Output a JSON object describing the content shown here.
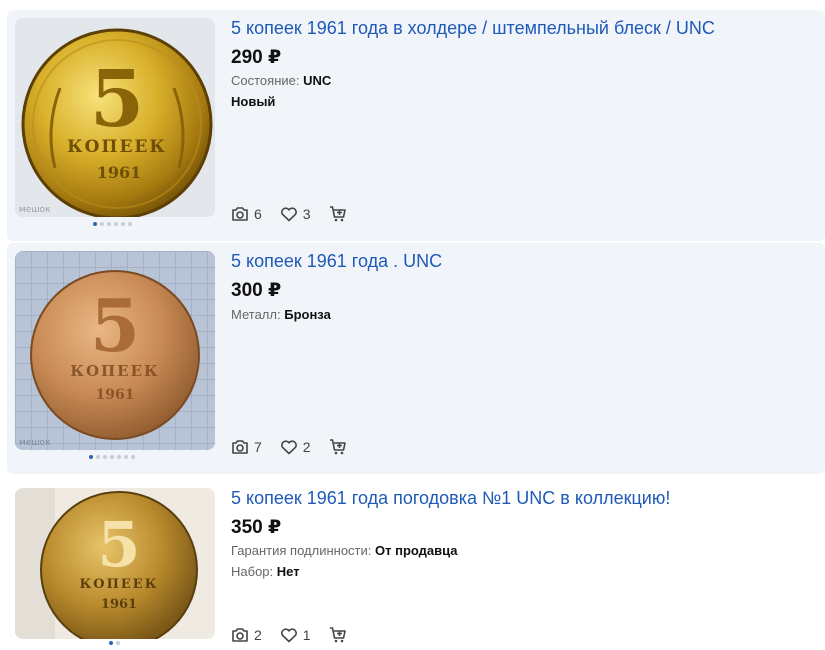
{
  "listings": [
    {
      "title": "5 копеек 1961 года в холдере / штемпельный блеск / UNC",
      "price": "290 ₽",
      "attributes": [
        {
          "label": "Состояние:",
          "value": "UNC"
        },
        {
          "label": "",
          "value": "Новый"
        }
      ],
      "photos": "6",
      "likes": "3",
      "image": {
        "coin_label": "5",
        "coin_word": "КОПЕЕК",
        "coin_year": "1961",
        "watermark": "мешок",
        "dots_total": 6,
        "dots_active": 0
      }
    },
    {
      "title": "5 копеек 1961 года . UNC",
      "price": "300 ₽",
      "attributes": [
        {
          "label": "Металл:",
          "value": "Бронза"
        }
      ],
      "photos": "7",
      "likes": "2",
      "image": {
        "coin_label": "5",
        "coin_word": "КОПЕЕК",
        "coin_year": "1961",
        "watermark": "мешок",
        "dots_total": 7,
        "dots_active": 0
      }
    },
    {
      "title": "5 копеек 1961 года погодовка №1 UNC в коллекцию!",
      "price": "350 ₽",
      "attributes": [
        {
          "label": "Гарантия подлинности:",
          "value": "От продавца"
        },
        {
          "label": "Набор:",
          "value": "Нет"
        }
      ],
      "photos": "2",
      "likes": "1",
      "image": {
        "coin_label": "5",
        "coin_word": "КОПЕЕК",
        "coin_year": "1961",
        "dots_total": 2,
        "dots_active": 0
      }
    }
  ],
  "colors": {
    "title_link": "#1e5ab8",
    "card_bg": "#f1f4f9",
    "dot_active": "#2a62b5",
    "dot_inactive": "#c8ccd4"
  },
  "icons": {
    "photo": "camera-icon",
    "like": "heart-icon",
    "cart": "add-to-cart-icon"
  }
}
